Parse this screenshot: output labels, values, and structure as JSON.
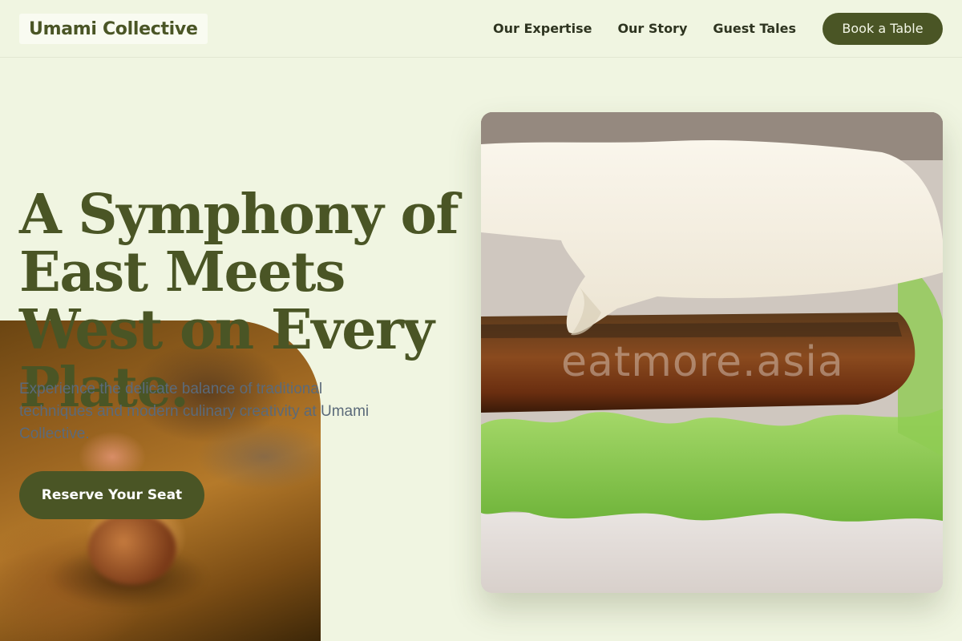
{
  "brand": {
    "name": "Umami Collective"
  },
  "nav": {
    "items": [
      "Our Expertise",
      "Our Story",
      "Guest Tales"
    ],
    "cta": "Book a Table"
  },
  "hero": {
    "title": "A Symphony of East Meets West on Every Plate.",
    "subtitle": "Experience the delicate balance of traditional techniques and modern culinary creativity at Umami Collective.",
    "cta": "Reserve Your Seat",
    "image_watermark": "eatmore.asia"
  },
  "colors": {
    "background": "#f0f5e1",
    "primary": "#4a5525",
    "nav_text": "#2e3420",
    "subtitle_text": "#5b6a7a"
  }
}
